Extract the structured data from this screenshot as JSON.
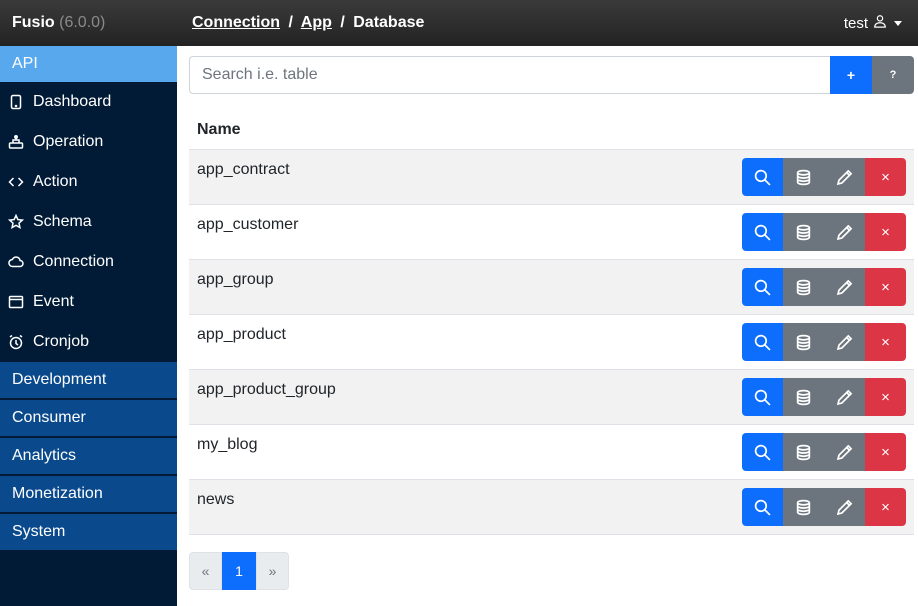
{
  "topbar": {
    "brand": "Fusio",
    "version": "(6.0.0)",
    "breadcrumbs": [
      "Connection",
      "App",
      "Database"
    ],
    "separator": "/",
    "user": "test"
  },
  "sidebar": {
    "header": "API",
    "items": [
      {
        "label": "Dashboard",
        "icon": "tablet-icon"
      },
      {
        "label": "Operation",
        "icon": "operation-icon"
      },
      {
        "label": "Action",
        "icon": "code-icon"
      },
      {
        "label": "Schema",
        "icon": "star-icon"
      },
      {
        "label": "Connection",
        "icon": "cloud-icon"
      },
      {
        "label": "Event",
        "icon": "window-icon"
      },
      {
        "label": "Cronjob",
        "icon": "alarm-icon"
      }
    ],
    "sections": [
      "Development",
      "Consumer",
      "Analytics",
      "Monetization",
      "System"
    ]
  },
  "search": {
    "placeholder": "Search i.e. table",
    "value": "",
    "add_label": "+",
    "help_label": "?"
  },
  "table": {
    "header": "Name",
    "rows": [
      "app_contract",
      "app_customer",
      "app_group",
      "app_product",
      "app_product_group",
      "my_blog",
      "news"
    ],
    "delete_label": "×"
  },
  "pagination": {
    "prev": "«",
    "current": "1",
    "next": "»"
  },
  "colors": {
    "primary": "#0d6efd",
    "secondary": "#6c757d",
    "danger": "#dc3545",
    "sidebar_bg": "#011b36",
    "sidebar_active": "#58a8ee",
    "sidebar_section": "#0a4a8c"
  }
}
